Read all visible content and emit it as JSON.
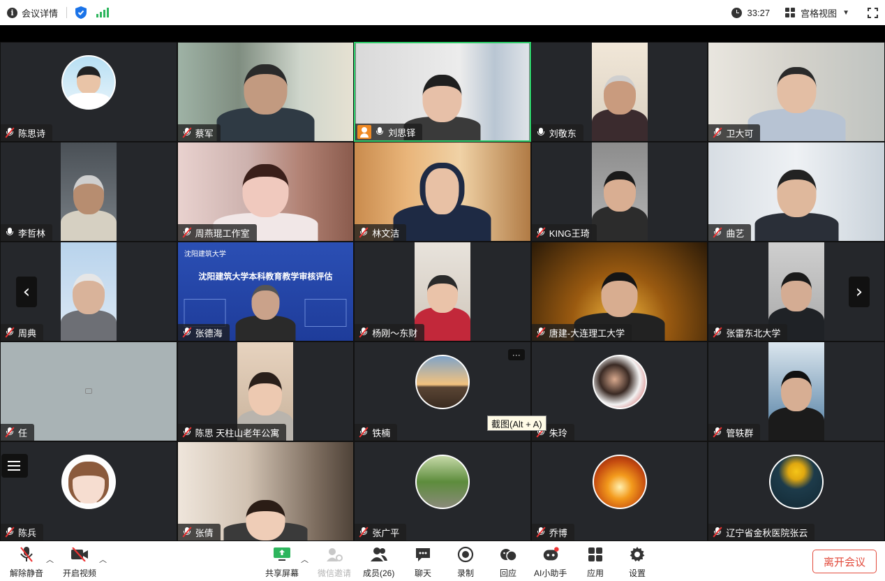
{
  "topbar": {
    "meeting_info": "会议详情",
    "timer": "33:27",
    "view_mode": "宫格视图"
  },
  "participants": [
    {
      "name": "陈思诗",
      "muted": true
    },
    {
      "name": "蔡军",
      "muted": true
    },
    {
      "name": "刘思铎",
      "muted": false,
      "host": true,
      "active_speaker": true
    },
    {
      "name": "刘敬东",
      "muted": false
    },
    {
      "name": "卫大可",
      "muted": true
    },
    {
      "name": "李哲林",
      "muted": false
    },
    {
      "name": "周燕琨工作室",
      "muted": true
    },
    {
      "name": "林文洁",
      "muted": true
    },
    {
      "name": "KING王琦",
      "muted": true
    },
    {
      "name": "曲艺",
      "muted": true
    },
    {
      "name": "周典",
      "muted": true
    },
    {
      "name": "张德海",
      "muted": true
    },
    {
      "name": "杨刚～东财",
      "muted": true
    },
    {
      "name": "唐建-大连理工大学",
      "muted": true
    },
    {
      "name": "张雷东北大学",
      "muted": true
    },
    {
      "name": "任",
      "muted": true
    },
    {
      "name": "陈思 天柱山老年公寓",
      "muted": true
    },
    {
      "name": "铁楠",
      "muted": true
    },
    {
      "name": "朱玲",
      "muted": true
    },
    {
      "name": "管轶群",
      "muted": true
    },
    {
      "name": "陈兵",
      "muted": true
    },
    {
      "name": "张倩",
      "muted": true
    },
    {
      "name": "张广平",
      "muted": true
    },
    {
      "name": "乔博",
      "muted": true
    },
    {
      "name": "辽宁省金秋医院张云",
      "muted": true
    }
  ],
  "shared_slide": {
    "school_logo_text": "沈阳建筑大学",
    "title": "沈阳建筑大学本科教育教学审核评估"
  },
  "tooltip": "截图(Alt + A)",
  "more_label": "···",
  "toolbar": {
    "unmute": "解除静音",
    "start_video": "开启视频",
    "share_screen": "共享屏幕",
    "wechat_invite": "微信邀请",
    "members": "成员(26)",
    "chat": "聊天",
    "record": "录制",
    "playback": "回应",
    "ai_assistant": "AI小助手",
    "apps": "应用",
    "settings": "设置",
    "leave": "离开会议"
  },
  "colors": {
    "active_border": "#2fcf6b",
    "leave": "#e24a3b",
    "tile_bg": "#25272b",
    "signal": "#2db55d"
  }
}
